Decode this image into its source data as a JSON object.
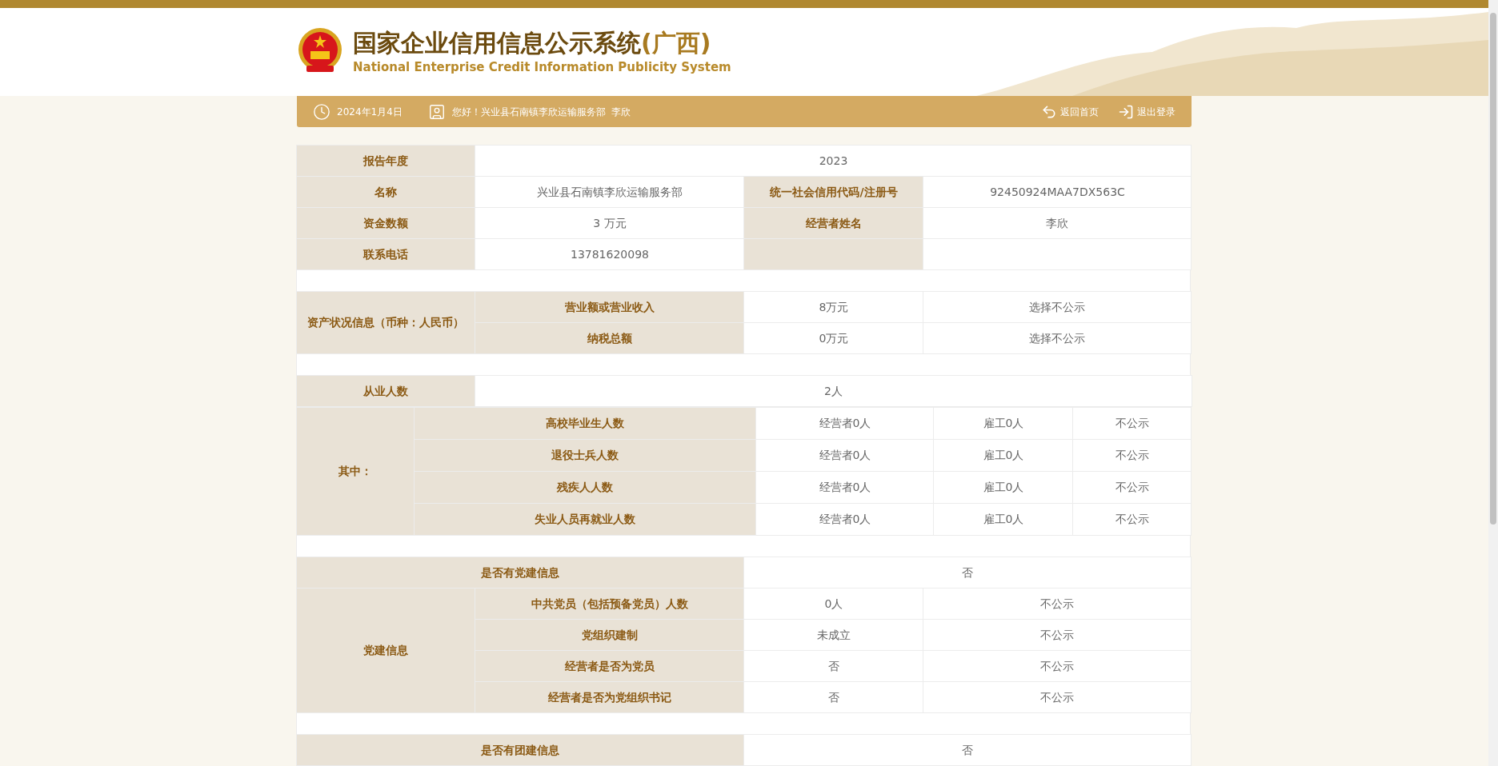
{
  "header": {
    "title": "国家企业信用信息公示系统",
    "region": "(广西)",
    "subtitle": "National Enterprise Credit Information Publicity System"
  },
  "nav": {
    "date": "2024年1月4日",
    "greeting": "您好！兴业县石南镇李欣运输服务部  李欣",
    "links": [
      {
        "kind": "home",
        "label": "返回首页"
      },
      {
        "kind": "logout",
        "label": "退出登录"
      }
    ]
  },
  "blocks": [
    {
      "tables": [
        {
          "kind": "standard",
          "rows": [
            [
              {
                "kind": "label",
                "text": "报告年度"
              },
              {
                "kind": "value",
                "text": "2023",
                "colspan": 3
              }
            ],
            [
              {
                "kind": "label",
                "text": "名称"
              },
              {
                "kind": "value",
                "text": "兴业县石南镇李欣运输服务部"
              },
              {
                "kind": "label",
                "text": "统一社会信用代码/注册号"
              },
              {
                "kind": "value",
                "text": "92450924MAA7DX563C"
              }
            ],
            [
              {
                "kind": "label",
                "text": "资金数额"
              },
              {
                "kind": "value",
                "text": "3 万元"
              },
              {
                "kind": "label",
                "text": "经营者姓名"
              },
              {
                "kind": "value",
                "text": "李欣"
              }
            ],
            [
              {
                "kind": "label",
                "text": "联系电话"
              },
              {
                "kind": "value",
                "text": "13781620098"
              },
              {
                "kind": "label"
              },
              {
                "kind": "value"
              }
            ]
          ]
        }
      ]
    },
    {
      "tables": [
        {
          "kind": "standard",
          "rows": [
            [
              {
                "kind": "label",
                "text": "资产状况信息（币种：人民币）",
                "rowspan": 2
              },
              {
                "kind": "label",
                "text": "营业额或营业收入"
              },
              {
                "kind": "value",
                "text": "8万元"
              },
              {
                "kind": "value",
                "text": "选择不公示"
              }
            ],
            [
              {
                "kind": "label",
                "text": "纳税总额"
              },
              {
                "kind": "value",
                "text": "0万元"
              },
              {
                "kind": "value",
                "text": "选择不公示"
              }
            ]
          ]
        }
      ]
    },
    {
      "tables": [
        {
          "kind": "standard",
          "rows": [
            [
              {
                "kind": "label",
                "text": "从业人数"
              },
              {
                "kind": "value",
                "text": "2人",
                "colspan": 3
              }
            ]
          ]
        },
        {
          "kind": "employees",
          "rows": [
            [
              {
                "kind": "label",
                "text": "其中：",
                "rowspan": 4
              },
              {
                "kind": "label",
                "text": "高校毕业生人数"
              },
              {
                "kind": "value",
                "text": "经营者0人"
              },
              {
                "kind": "value",
                "text": "雇工0人"
              },
              {
                "kind": "value",
                "text": "不公示"
              }
            ],
            [
              {
                "kind": "label",
                "text": "退役士兵人数"
              },
              {
                "kind": "value",
                "text": "经营者0人"
              },
              {
                "kind": "value",
                "text": "雇工0人"
              },
              {
                "kind": "value",
                "text": "不公示"
              }
            ],
            [
              {
                "kind": "label",
                "text": "残疾人人数"
              },
              {
                "kind": "value",
                "text": "经营者0人"
              },
              {
                "kind": "value",
                "text": "雇工0人"
              },
              {
                "kind": "value",
                "text": "不公示"
              }
            ],
            [
              {
                "kind": "label",
                "text": "失业人员再就业人数"
              },
              {
                "kind": "value",
                "text": "经营者0人"
              },
              {
                "kind": "value",
                "text": "雇工0人"
              },
              {
                "kind": "value",
                "text": "不公示"
              }
            ]
          ]
        }
      ]
    },
    {
      "tables": [
        {
          "kind": "standard",
          "rows": [
            [
              {
                "kind": "label",
                "text": "是否有党建信息",
                "colspan": 2
              },
              {
                "kind": "value",
                "text": "否",
                "colspan": 2
              }
            ],
            [
              {
                "kind": "label",
                "text": "党建信息",
                "rowspan": 4
              },
              {
                "kind": "label",
                "text": "中共党员（包括预备党员）人数"
              },
              {
                "kind": "value",
                "text": "0人"
              },
              {
                "kind": "value",
                "text": "不公示"
              }
            ],
            [
              {
                "kind": "label",
                "text": "党组织建制"
              },
              {
                "kind": "value",
                "text": "未成立"
              },
              {
                "kind": "value",
                "text": "不公示"
              }
            ],
            [
              {
                "kind": "label",
                "text": "经营者是否为党员"
              },
              {
                "kind": "value",
                "text": "否"
              },
              {
                "kind": "value",
                "text": "不公示"
              }
            ],
            [
              {
                "kind": "label",
                "text": "经营者是否为党组织书记"
              },
              {
                "kind": "value",
                "text": "否"
              },
              {
                "kind": "value",
                "text": "不公示"
              }
            ]
          ]
        }
      ]
    },
    {
      "tables": [
        {
          "kind": "standard",
          "rows": [
            [
              {
                "kind": "label",
                "text": "是否有团建信息",
                "colspan": 2
              },
              {
                "kind": "value",
                "text": "否",
                "colspan": 2
              }
            ]
          ]
        }
      ]
    }
  ]
}
